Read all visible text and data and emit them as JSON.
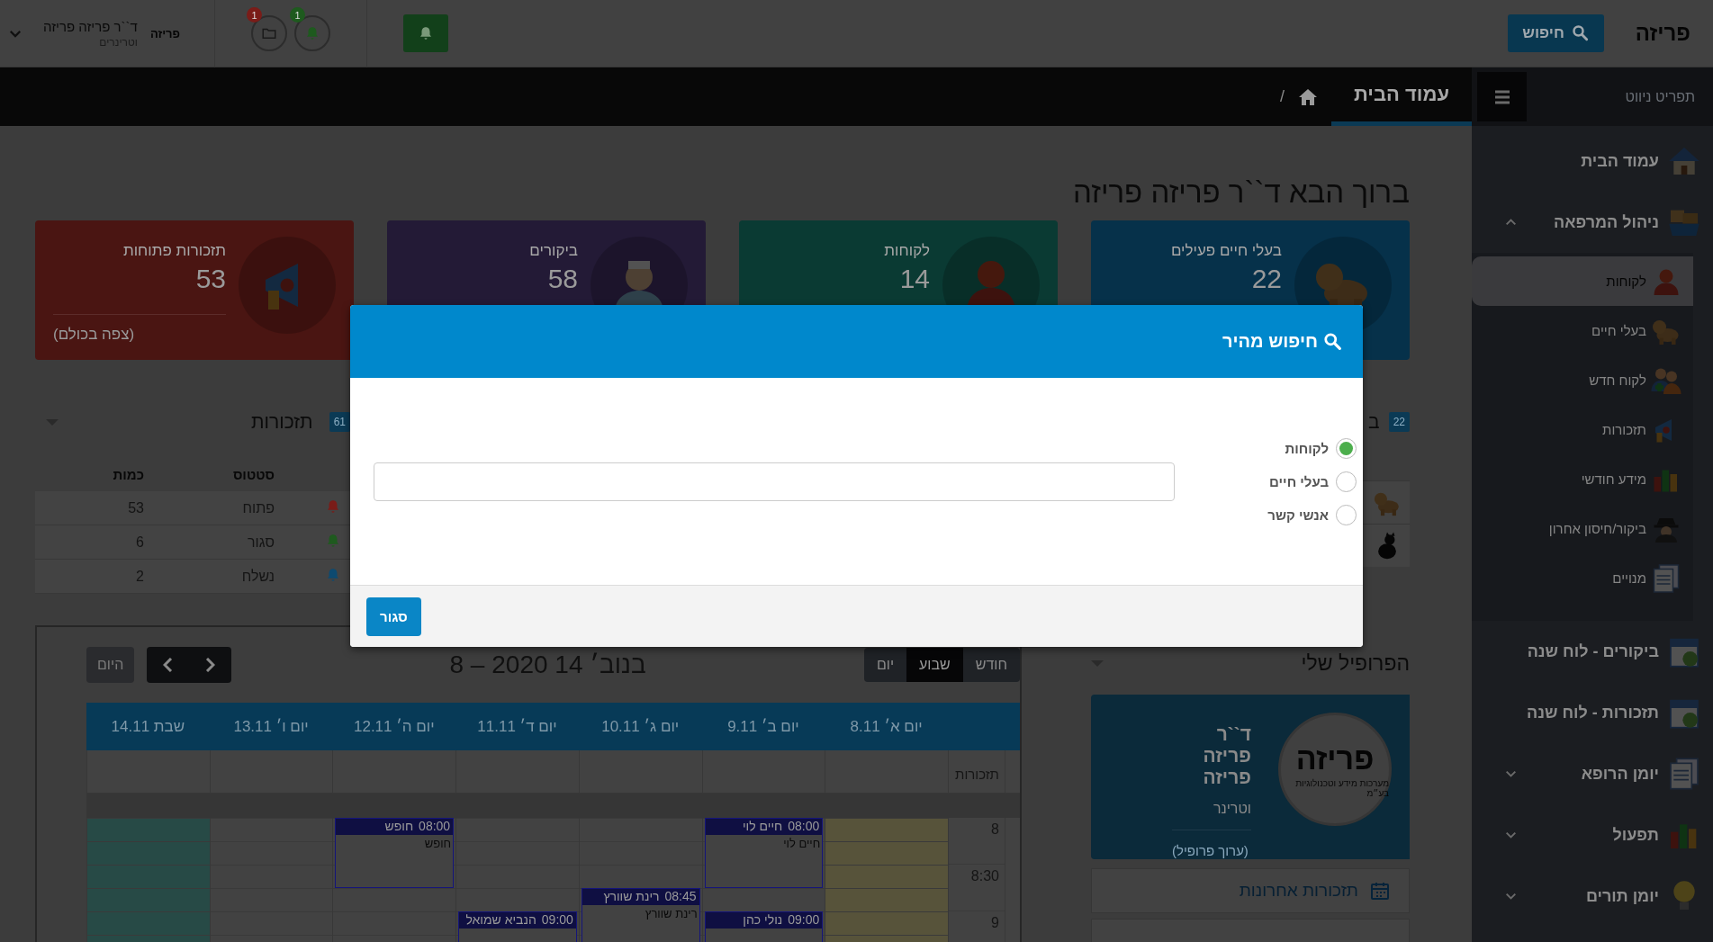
{
  "topbar": {
    "logo": "פריזה",
    "search_button": "חיפוש",
    "alert_button": {
      "kind": "bell"
    },
    "notifications": [
      {
        "kind": "bell",
        "badge": "1",
        "color": "#1e5a1e"
      },
      {
        "kind": "folder",
        "badge": "1",
        "color": "#7a1c18"
      }
    ],
    "user": {
      "logo": "פריזה",
      "name": "ד``ר פריזה פריזה",
      "role": "וטרינרים"
    }
  },
  "breadcrumb": {
    "title": "עמוד הבית",
    "separator": "/"
  },
  "sidebar": {
    "header": "תפריט ניווט",
    "items": [
      {
        "label": "עמוד הבית",
        "kind": "link",
        "selected": false
      },
      {
        "label": "ניהול המרפאה",
        "kind": "group",
        "selected": false,
        "expanded": true,
        "children": [
          {
            "label": "לקוחות",
            "selected": true
          },
          {
            "label": "בעלי חיים",
            "selected": false
          },
          {
            "label": "לקוח חדש",
            "selected": false
          },
          {
            "label": "תזכורות",
            "selected": false
          },
          {
            "label": "מידע חודשי",
            "selected": false
          },
          {
            "label": "ביקור/חיסון אחרון",
            "selected": false
          },
          {
            "label": "מנויים",
            "selected": false
          }
        ]
      },
      {
        "label": "ביקורים - לוח שנה",
        "kind": "link",
        "selected": false
      },
      {
        "label": "תזכורות - לוח שנה",
        "kind": "link",
        "selected": false
      },
      {
        "label": "יומן הרופא",
        "kind": "group",
        "selected": false,
        "expanded": false
      },
      {
        "label": "תפעול",
        "kind": "group",
        "selected": false,
        "expanded": false
      },
      {
        "label": "יומן תורים",
        "kind": "group",
        "selected": false,
        "expanded": false
      }
    ]
  },
  "welcome": "ברוך הבא ד``ר פריזה פריזה",
  "stats": [
    {
      "label": "בעלי חיים פעילים",
      "value": "22",
      "color": "#06314a"
    },
    {
      "label": "לקוחות",
      "value": "14",
      "color": "#0a3a33"
    },
    {
      "label": "ביקורים",
      "value": "58",
      "color": "#231a36"
    },
    {
      "label": "תזכורות פתוחות",
      "value": "53",
      "color": "#4a1512",
      "link": "(צפה בכולם)"
    }
  ],
  "reminders": {
    "title": "תזכורות",
    "count": "61",
    "columns": [
      "סטטוס",
      "כמות"
    ],
    "rows": [
      {
        "status": "פתוח",
        "quantity": "53",
        "color": "#7a1c18"
      },
      {
        "status": "סגור",
        "quantity": "6",
        "color": "#1e5a1e"
      },
      {
        "status": "נשלח",
        "quantity": "2",
        "color": "#0d4a70"
      }
    ]
  },
  "calendar": {
    "today_button": {
      "label": "היום",
      "disabled": true
    },
    "title": "בנוב׳ 14 2020 – 8",
    "views": [
      {
        "label": "חודש",
        "selected": false
      },
      {
        "label": "שבוע",
        "selected": true
      },
      {
        "label": "יום",
        "selected": false
      }
    ],
    "allday_label": "תזכורות",
    "times": [
      "8",
      "8:30",
      "9"
    ],
    "days": [
      {
        "label": "יום א׳ 8.11",
        "today": true,
        "closed": false
      },
      {
        "label": "יום ב׳ 9.11",
        "today": false,
        "closed": false,
        "events": [
          {
            "time": "08:00",
            "title": "חיים לוי",
            "body": "חיים לוי"
          },
          {
            "time": "09:00",
            "title": "נולי כהן"
          }
        ]
      },
      {
        "label": "יום ג׳ 10.11",
        "today": false,
        "closed": false,
        "events": [
          {
            "time": "08:45",
            "title": "רינת שוורץ",
            "body": "רינת שוורץ"
          }
        ]
      },
      {
        "label": "יום ד׳ 11.11",
        "today": false,
        "closed": false,
        "events": [
          {
            "time": "09:00",
            "title": "הנביא שמואל"
          }
        ]
      },
      {
        "label": "יום ה׳ 12.11",
        "today": false,
        "closed": false,
        "events": [
          {
            "time": "08:00",
            "title": "חופש",
            "body": "חופש"
          }
        ]
      },
      {
        "label": "יום ו׳ 13.11",
        "today": false,
        "closed": false
      },
      {
        "label": "שבת 14.11",
        "today": false,
        "closed": true
      }
    ]
  },
  "animals_panel": {
    "badge": "22",
    "heading": "ב",
    "rows": [
      {
        "kind": "dog"
      },
      {
        "kind": "cat"
      }
    ]
  },
  "profile": {
    "heading": "הפרופיל שלי",
    "logo": "פריזה",
    "logo_tagline": "מערכות מידע וטכנולוגיות בע״מ",
    "title": "ד``ר",
    "name": "פריזה פריזה",
    "role": "וטרינר",
    "edit_link": "(ערוך פרופיל)",
    "recent": "תזכורות אחרונות"
  },
  "modal": {
    "title": "חיפוש מהיר",
    "options": [
      {
        "label": "לקוחות",
        "selected": true
      },
      {
        "label": "בעלי חיים",
        "selected": false
      },
      {
        "label": "אנשי קשר",
        "selected": false
      }
    ],
    "close_button": "סגור"
  }
}
